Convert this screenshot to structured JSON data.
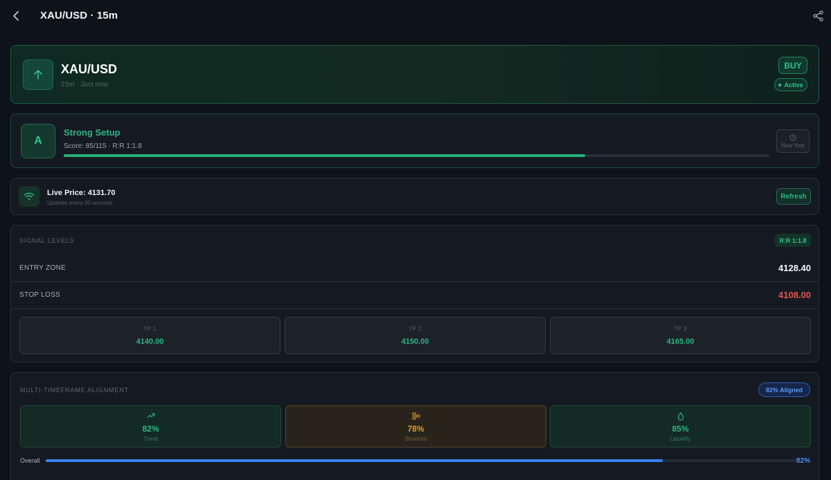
{
  "header": {
    "title": "XAU/USD · 15m"
  },
  "signal": {
    "symbol": "XAU/USD",
    "meta": "15m · Just now",
    "direction": "BUY",
    "status": "Active"
  },
  "setup": {
    "grade": "A",
    "title": "Strong Setup",
    "subtitle": "Score: 85/115  ·  R:R 1:1.8",
    "score_fraction": 0.739,
    "session": "New York"
  },
  "live": {
    "label": "Live Price: 4131.70",
    "sub": "Updates every 30 seconds",
    "refresh_label": "Refresh"
  },
  "levels": {
    "title": "SIGNAL LEVELS",
    "rr": "R:R 1:1.8",
    "entry_label": "ENTRY ZONE",
    "entry_value": "4128.40",
    "stop_label": "STOP LOSS",
    "stop_value": "4108.00",
    "targets": [
      {
        "label": "TP 1",
        "value": "4140.00"
      },
      {
        "label": "TP 2",
        "value": "4150.00"
      },
      {
        "label": "TP 3",
        "value": "4165.00"
      }
    ]
  },
  "alignment": {
    "title": "MULTI-TIMEFRAME ALIGNMENT",
    "badge": "82% Aligned",
    "timeframes": [
      {
        "pct": "82%",
        "name": "Trend",
        "icon": "trend-icon"
      },
      {
        "pct": "78%",
        "name": "Structure",
        "icon": "structure-icon"
      },
      {
        "pct": "85%",
        "name": "Liquidity",
        "icon": "liquidity-icon"
      }
    ],
    "overall_label": "Overall",
    "overall_pct": "82%",
    "overall_fraction": 0.82
  },
  "colors": {
    "accent_green": "#2fb582",
    "danger_red": "#e5534b",
    "amber": "#e59a2c",
    "blue": "#3b82f0"
  }
}
